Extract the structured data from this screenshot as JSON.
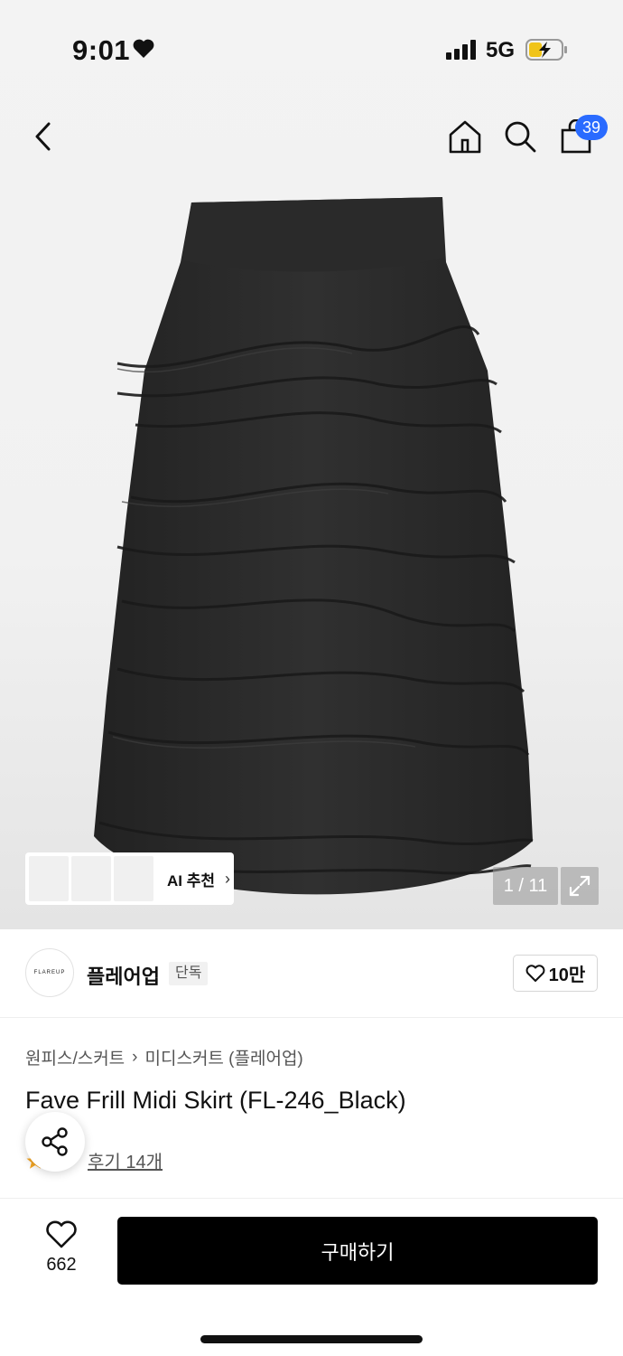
{
  "status_bar": {
    "time": "9:01",
    "network": "5G"
  },
  "header": {
    "cart_count": "39"
  },
  "gallery": {
    "ai_label": "AI 추천",
    "ai_chevron": "›",
    "page_counter": "1 / 11"
  },
  "brand": {
    "logo_text": "FLAREUP",
    "name": "플레어업",
    "badge": "단독",
    "likes": "10만"
  },
  "breadcrumb": {
    "items": [
      "원피스/스커트",
      "미디스커트 (플레어업)"
    ],
    "separator": "›"
  },
  "product": {
    "title": "Fave Frill Midi Skirt (FL-246_Black)",
    "review_label": "후기 14개"
  },
  "bottom_bar": {
    "wish_count": "662",
    "buy_label": "구매하기"
  },
  "colors": {
    "accent_badge": "#2a6bff",
    "buy_button": "#000000",
    "skirt": "#2b2b2b"
  },
  "icons": [
    "heart-icon",
    "signal-icon",
    "battery-icon",
    "back-chevron-icon",
    "home-icon",
    "search-icon",
    "bag-icon",
    "expand-icon",
    "share-icon",
    "star-icon"
  ]
}
